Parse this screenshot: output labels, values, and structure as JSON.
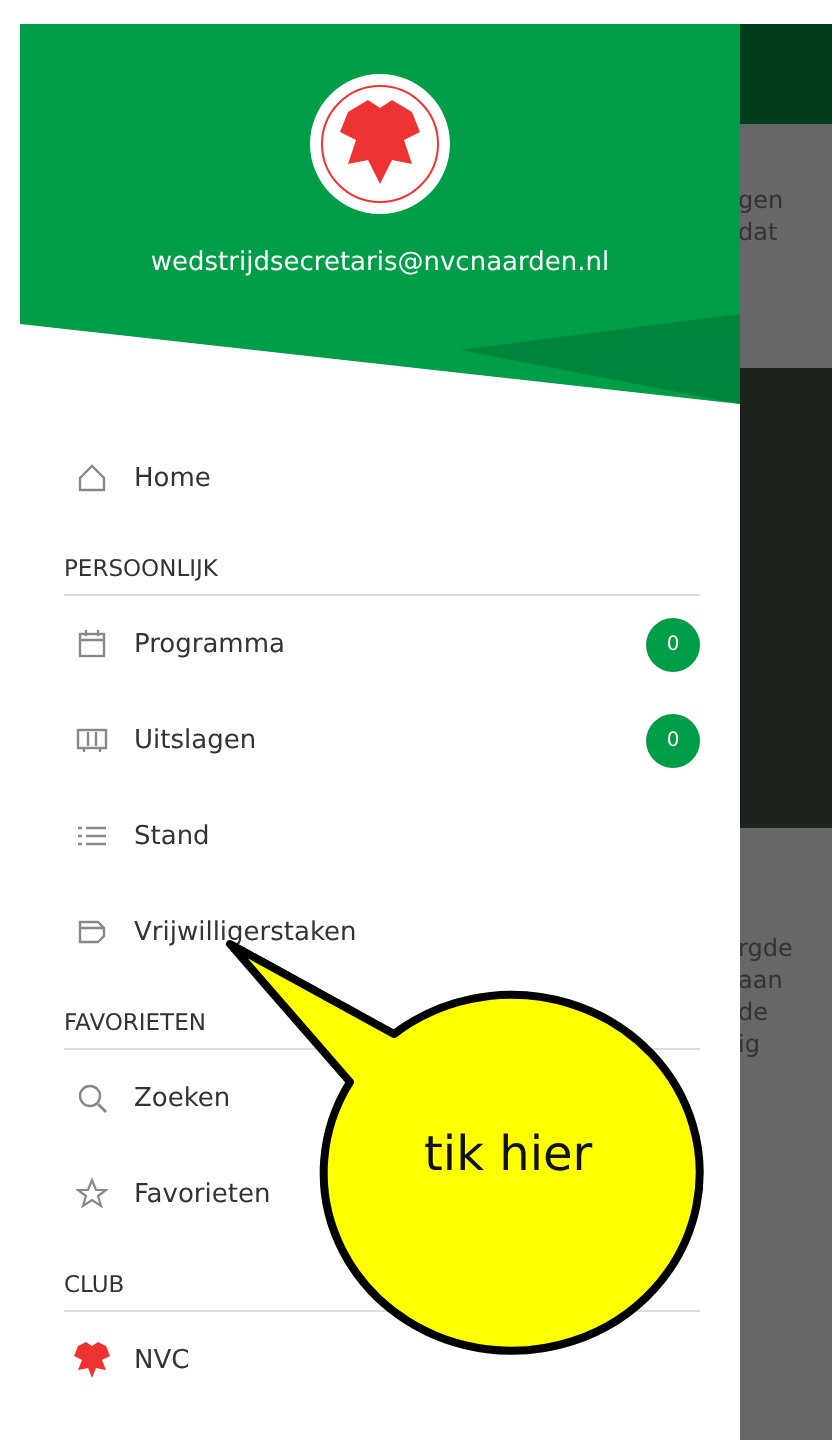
{
  "drawer": {
    "email": "wedstrijdsecretaris@nvcnaarden.nl",
    "home": {
      "label": "Home"
    },
    "sections": [
      {
        "title": "PERSOONLIJK",
        "items": [
          {
            "label": "Programma",
            "badge": "0"
          },
          {
            "label": "Uitslagen",
            "badge": "0"
          },
          {
            "label": "Stand"
          },
          {
            "label": "Vrijwilligerstaken"
          }
        ]
      },
      {
        "title": "FAVORIETEN",
        "items": [
          {
            "label": "Zoeken"
          },
          {
            "label": "Favorieten"
          }
        ]
      },
      {
        "title": "CLUB",
        "items": [
          {
            "label": "NVC"
          }
        ]
      }
    ]
  },
  "background": {
    "top_lines": [
      "gen",
      "dat"
    ],
    "lower_lines": [
      "rgde",
      "aan",
      "de",
      "ig"
    ]
  },
  "callout": {
    "text": "tik hier"
  }
}
